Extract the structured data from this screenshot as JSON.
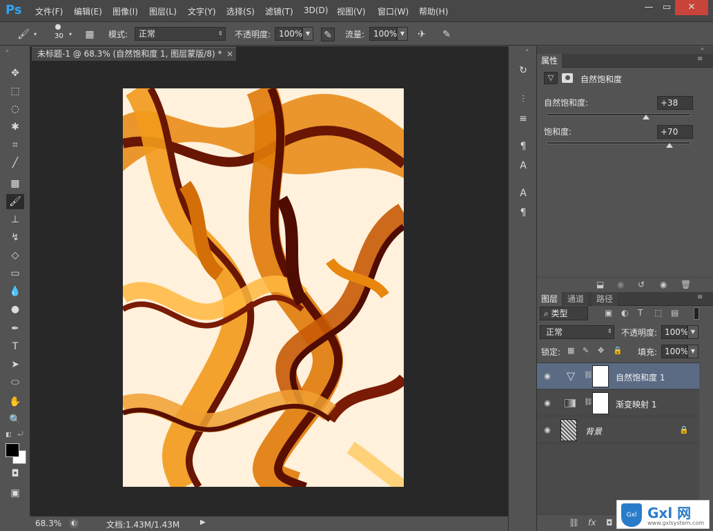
{
  "app": {
    "logo": "Ps"
  },
  "menu": [
    "文件(F)",
    "编辑(E)",
    "图像(I)",
    "图层(L)",
    "文字(Y)",
    "选择(S)",
    "滤镜(T)",
    "3D(D)",
    "视图(V)",
    "窗口(W)",
    "帮助(H)"
  ],
  "window_controls": {
    "minimize": "—",
    "maximize": "▭",
    "close": "✕"
  },
  "options": {
    "brush_size": "30",
    "mode_label": "模式:",
    "mode_value": "正常",
    "opacity_label": "不透明度:",
    "opacity_value": "100%",
    "flow_label": "流量:",
    "flow_value": "100%"
  },
  "document": {
    "tab_title": "未标题-1 @ 68.3% (自然饱和度 1, 图层蒙版/8) *",
    "close": "×",
    "zoom": "68.3%",
    "doc_info": "文档:1.43M/1.43M"
  },
  "properties": {
    "tab": "属性",
    "title": "自然饱和度",
    "vibrance_label": "自然饱和度:",
    "vibrance_value": "+38",
    "vibrance_level": 0.69,
    "saturation_label": "饱和度:",
    "saturation_value": "+70",
    "saturation_level": 0.85
  },
  "layers": {
    "tabs": [
      "图层",
      "通道",
      "路径"
    ],
    "filter_label": "类型",
    "blend_mode": "正常",
    "opacity_label": "不透明度:",
    "opacity_value": "100%",
    "lock_label": "锁定:",
    "fill_label": "填充:",
    "fill_value": "100%",
    "items": [
      {
        "name": "自然饱和度 1",
        "selected": true
      },
      {
        "name": "渐变映射 1",
        "selected": false
      },
      {
        "name": "背景",
        "selected": false
      }
    ]
  },
  "watermark": {
    "text": "Gxl 网",
    "url": "www.gxlsystem.com"
  },
  "colors": {
    "accent": "#2fa3f6",
    "selection": "#5b6b84",
    "canvas_dark": "#7a1b05",
    "canvas_orange": "#e8860e"
  }
}
